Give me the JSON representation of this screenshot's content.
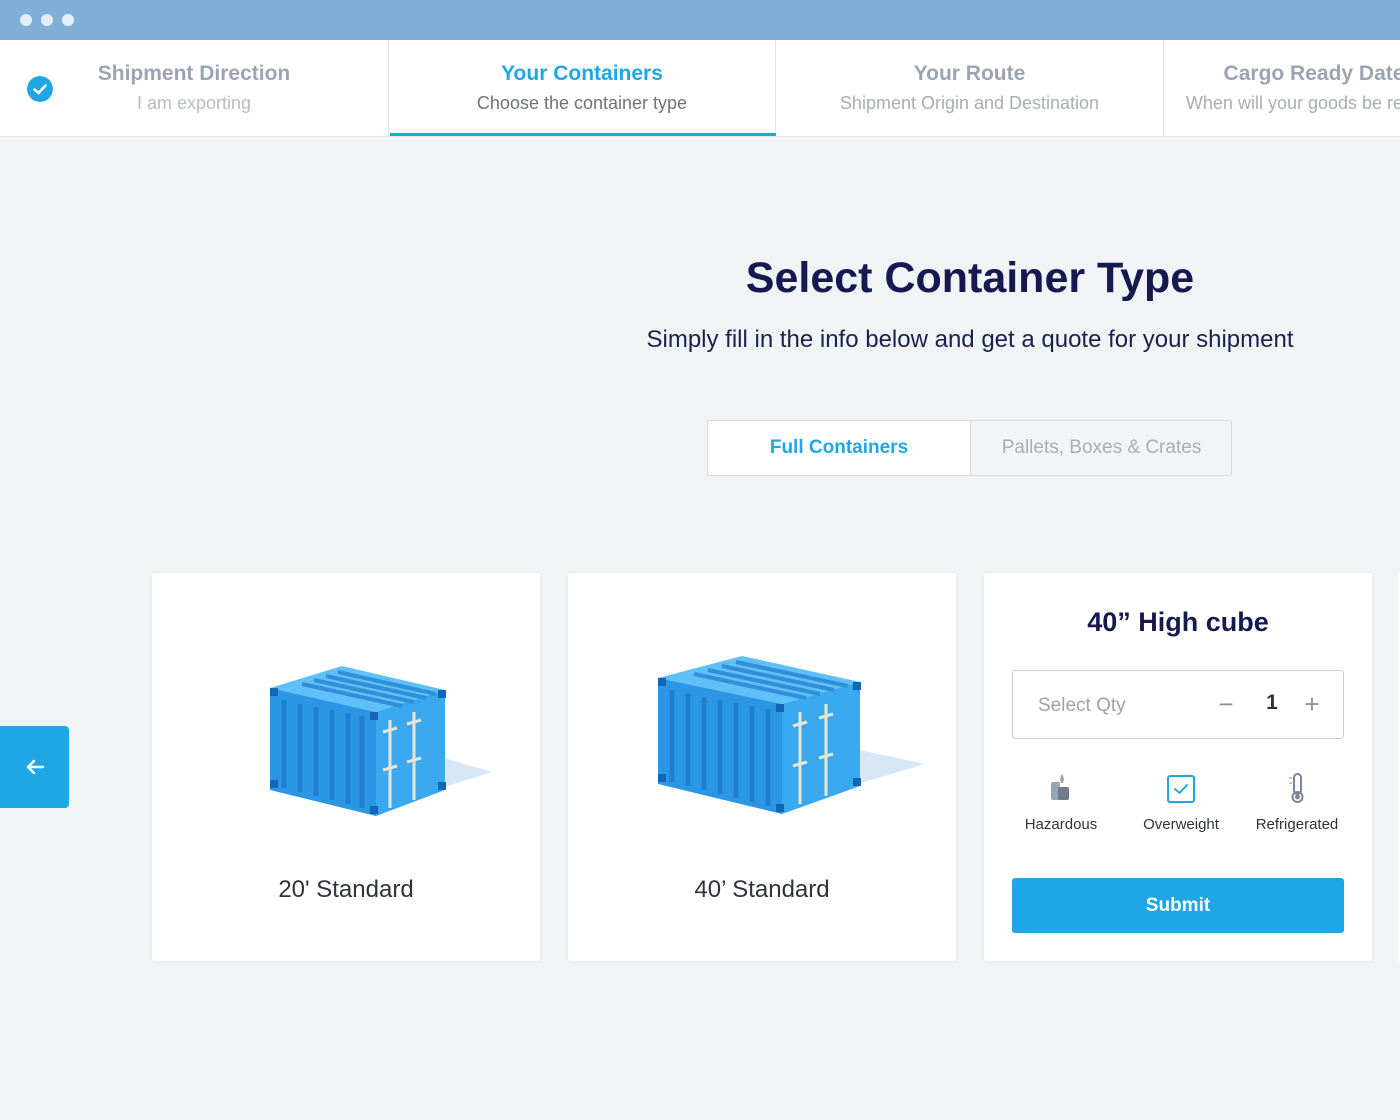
{
  "steps": [
    {
      "title": "Shipment Direction",
      "sub": "I am exporting"
    },
    {
      "title": "Your Containers",
      "sub": "Choose the container type"
    },
    {
      "title": "Your Route",
      "sub": "Shipment Origin and Destination"
    },
    {
      "title": "Cargo Ready Date",
      "sub": "When will your goods be ready?"
    }
  ],
  "page": {
    "title": "Select Container Type",
    "subtitle": "Simply fill in the info below and get a quote for your shipment"
  },
  "toggle": {
    "selected": "Full Containers",
    "other": "Pallets, Boxes & Crates"
  },
  "cards": [
    {
      "label": "20' Standard"
    },
    {
      "label": "40’ Standard"
    }
  ],
  "high_cube": {
    "title": "40” High cube",
    "qty_label": "Select Qty",
    "qty_value": "1",
    "minus": "−",
    "plus": "+",
    "options": [
      {
        "label": "Hazardous",
        "icon": "hazardous-icon",
        "checked": false
      },
      {
        "label": "Overweight",
        "icon": "overweight-checkbox-icon",
        "checked": true
      },
      {
        "label": "Refrigerated",
        "icon": "thermometer-icon",
        "checked": false
      }
    ],
    "submit": "Submit"
  },
  "colors": {
    "accent": "#1ea7e4",
    "heading": "#15194f",
    "container": "#2a9be6"
  }
}
